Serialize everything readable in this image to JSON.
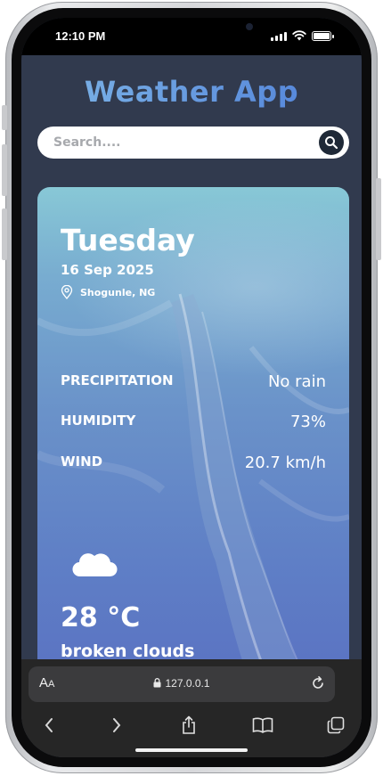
{
  "status_bar": {
    "time": "12:10 PM"
  },
  "app": {
    "title": "Weather App",
    "search": {
      "placeholder": "Search...."
    }
  },
  "weather": {
    "day": "Tuesday",
    "date": "16 Sep 2025",
    "location": "Shogunle, NG",
    "stats": [
      {
        "label": "PRECIPITATION",
        "value": "No rain"
      },
      {
        "label": "HUMIDITY",
        "value": "73%"
      },
      {
        "label": "WIND",
        "value": "20.7 km/h"
      }
    ],
    "temperature": "28 °C",
    "description": "broken clouds",
    "icon": "cloud-icon"
  },
  "browser": {
    "text_size_label_big": "A",
    "text_size_label_small": "A",
    "url": "127.0.0.1"
  },
  "colors": {
    "screen_bg": "#313a4e",
    "title_gradient_start": "#7fb7e8",
    "title_gradient_end": "#4f7fd8",
    "browser_bar": "#262626"
  }
}
